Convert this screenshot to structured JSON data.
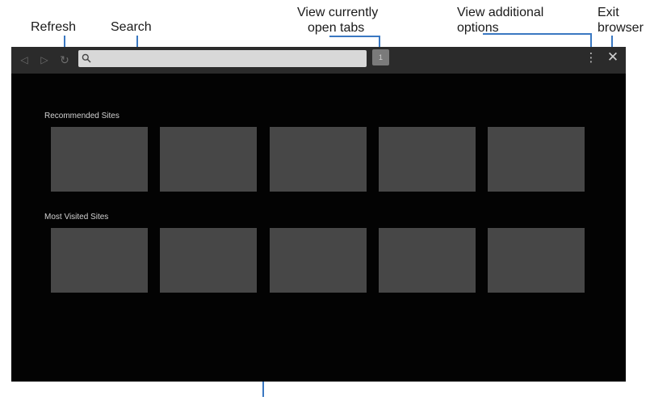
{
  "callouts": {
    "refresh": "Refresh",
    "search": "Search",
    "tabs_line1": "View currently",
    "tabs_line2": "open tabs",
    "options_line1": "View additional",
    "options_line2": "options",
    "exit_line1": "Exit",
    "exit_line2": "browser"
  },
  "toolbar": {
    "back_icon": "◁",
    "forward_icon": "▷",
    "refresh_icon": "↻",
    "search_icon": "search-icon",
    "tab_count": "1",
    "more_icon": "⋮",
    "close_icon": "✕"
  },
  "sections": {
    "recommended_title": "Recommended Sites",
    "most_visited_title": "Most Visited Sites"
  },
  "colors": {
    "accent": "#3a78c2",
    "screen_bg": "#030303",
    "toolbar_bg": "#2b2b2b",
    "tile_bg": "#474747"
  }
}
